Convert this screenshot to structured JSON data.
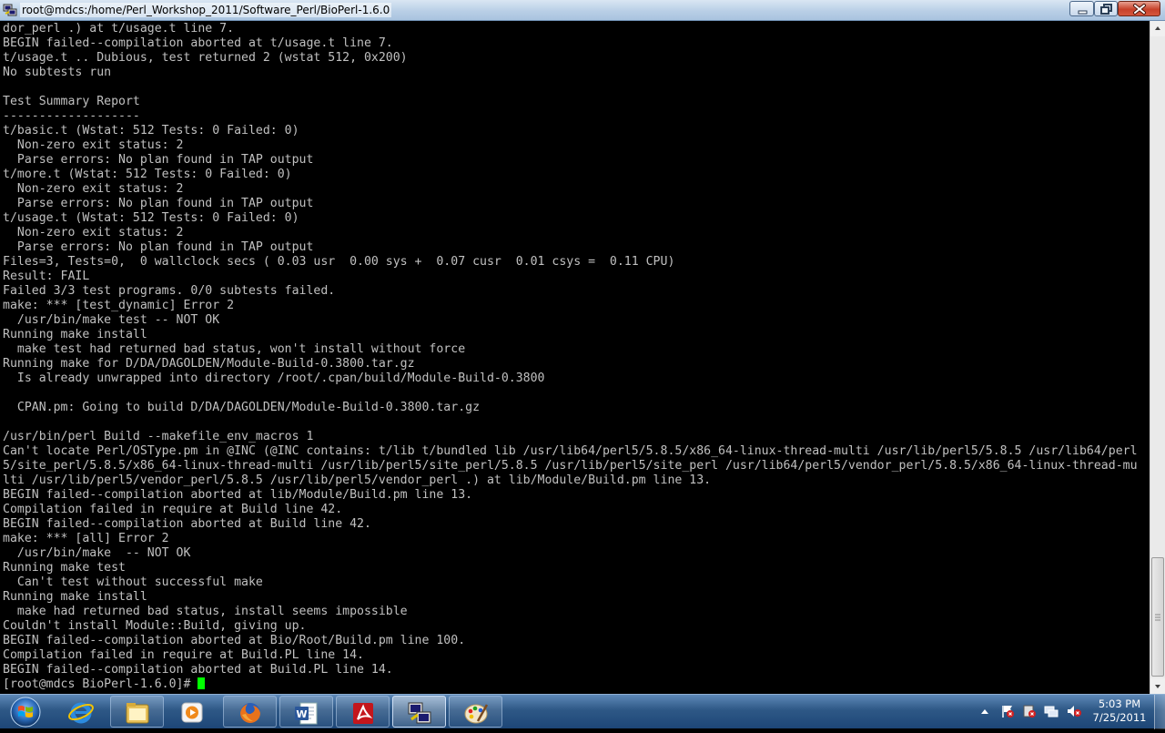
{
  "window": {
    "title": "root@mdcs:/home/Perl_Workshop_2011/Software_Perl/BioPerl-1.6.0"
  },
  "terminal": {
    "lines": [
      "dor_perl .) at t/usage.t line 7.",
      "BEGIN failed--compilation aborted at t/usage.t line 7.",
      "t/usage.t .. Dubious, test returned 2 (wstat 512, 0x200)",
      "No subtests run",
      "",
      "Test Summary Report",
      "-------------------",
      "t/basic.t (Wstat: 512 Tests: 0 Failed: 0)",
      "  Non-zero exit status: 2",
      "  Parse errors: No plan found in TAP output",
      "t/more.t (Wstat: 512 Tests: 0 Failed: 0)",
      "  Non-zero exit status: 2",
      "  Parse errors: No plan found in TAP output",
      "t/usage.t (Wstat: 512 Tests: 0 Failed: 0)",
      "  Non-zero exit status: 2",
      "  Parse errors: No plan found in TAP output",
      "Files=3, Tests=0,  0 wallclock secs ( 0.03 usr  0.00 sys +  0.07 cusr  0.01 csys =  0.11 CPU)",
      "Result: FAIL",
      "Failed 3/3 test programs. 0/0 subtests failed.",
      "make: *** [test_dynamic] Error 2",
      "  /usr/bin/make test -- NOT OK",
      "Running make install",
      "  make test had returned bad status, won't install without force",
      "Running make for D/DA/DAGOLDEN/Module-Build-0.3800.tar.gz",
      "  Is already unwrapped into directory /root/.cpan/build/Module-Build-0.3800",
      "",
      "  CPAN.pm: Going to build D/DA/DAGOLDEN/Module-Build-0.3800.tar.gz",
      "",
      "/usr/bin/perl Build --makefile_env_macros 1",
      "Can't locate Perl/OSType.pm in @INC (@INC contains: t/lib t/bundled lib /usr/lib64/perl5/5.8.5/x86_64-linux-thread-multi /usr/lib/perl5/5.8.5 /usr/lib64/perl",
      "5/site_perl/5.8.5/x86_64-linux-thread-multi /usr/lib/perl5/site_perl/5.8.5 /usr/lib/perl5/site_perl /usr/lib64/perl5/vendor_perl/5.8.5/x86_64-linux-thread-mu",
      "lti /usr/lib/perl5/vendor_perl/5.8.5 /usr/lib/perl5/vendor_perl .) at lib/Module/Build.pm line 13.",
      "BEGIN failed--compilation aborted at lib/Module/Build.pm line 13.",
      "Compilation failed in require at Build line 42.",
      "BEGIN failed--compilation aborted at Build line 42.",
      "make: *** [all] Error 2",
      "  /usr/bin/make  -- NOT OK",
      "Running make test",
      "  Can't test without successful make",
      "Running make install",
      "  make had returned bad status, install seems impossible",
      "Couldn't install Module::Build, giving up.",
      "BEGIN failed--compilation aborted at Bio/Root/Build.pm line 100.",
      "Compilation failed in require at Build.PL line 14.",
      "BEGIN failed--compilation aborted at Build.PL line 14."
    ],
    "prompt": "[root@mdcs BioPerl-1.6.0]#",
    "text_color": "#c0c0c0",
    "cursor_color": "#00ff00"
  },
  "taskbar": {
    "items": [
      {
        "name": "internet-explorer-icon"
      },
      {
        "name": "windows-explorer-icon"
      },
      {
        "name": "media-player-icon"
      },
      {
        "name": "firefox-icon"
      },
      {
        "name": "word-icon"
      },
      {
        "name": "adobe-reader-icon"
      },
      {
        "name": "putty-icon"
      },
      {
        "name": "paint-icon"
      }
    ],
    "clock": {
      "time": "5:03 PM",
      "date": "7/25/2011"
    }
  }
}
